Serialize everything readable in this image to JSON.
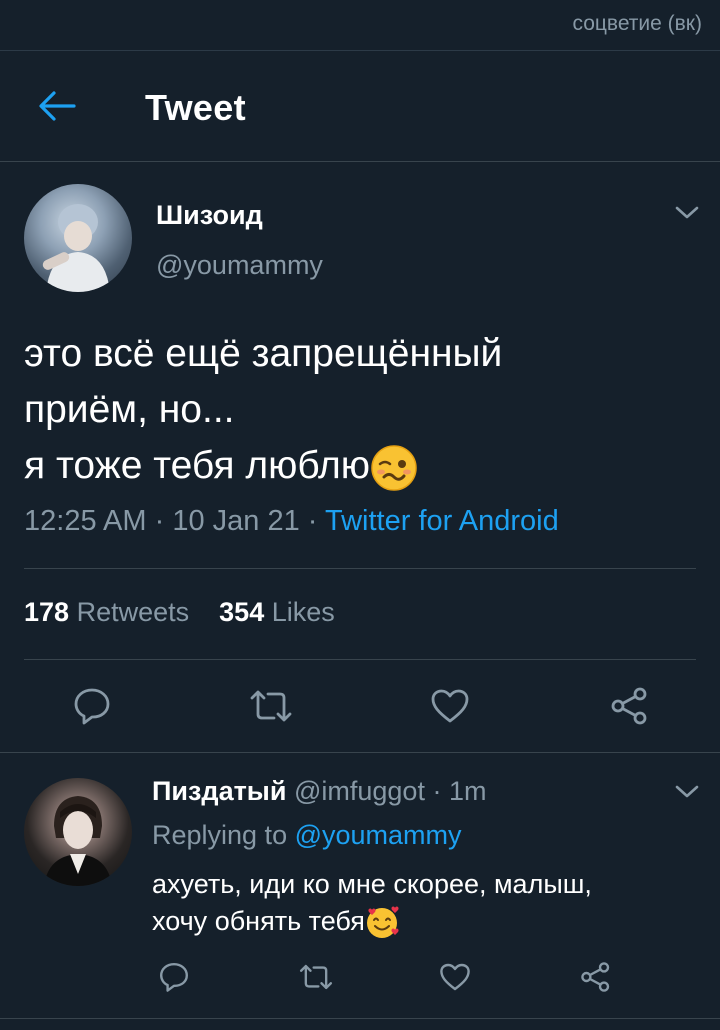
{
  "watermark": "соцветие (вк)",
  "header": {
    "title": "Tweet"
  },
  "tweet": {
    "author_name": "Шизоид",
    "author_handle": "@youmammy",
    "text_lines": [
      "это всё ещё запрещённый",
      "приём, но...",
      "я тоже тебя люблю"
    ],
    "time": "12:25 AM",
    "date": "10 Jan 21",
    "source": "Twitter for Android",
    "dot": "·",
    "retweets_count": "178",
    "retweets_label": "Retweets",
    "likes_count": "354",
    "likes_label": "Likes"
  },
  "reply": {
    "author_name": "Пиздатый",
    "author_handle": "@imfuggot",
    "time": "1m",
    "dot": "·",
    "replying_prefix": "Replying to",
    "replying_mention": "@youmammy",
    "text_lines": [
      "ахуеть, иди ко мне скорее, малыш,",
      "хочу обнять тебя"
    ]
  },
  "colors": {
    "background": "#15202b",
    "accent": "#1da1f2",
    "secondary_text": "#8899a6",
    "divider": "#38444d"
  },
  "icons": {
    "back": "arrow-left-icon",
    "more": "chevron-down-icon",
    "reply": "comment-icon",
    "retweet": "retweet-icon",
    "like": "heart-icon",
    "share": "share-icon",
    "emoji_tweet": "woozy-face-emoji",
    "emoji_reply": "smiling-face-with-hearts-emoji"
  }
}
